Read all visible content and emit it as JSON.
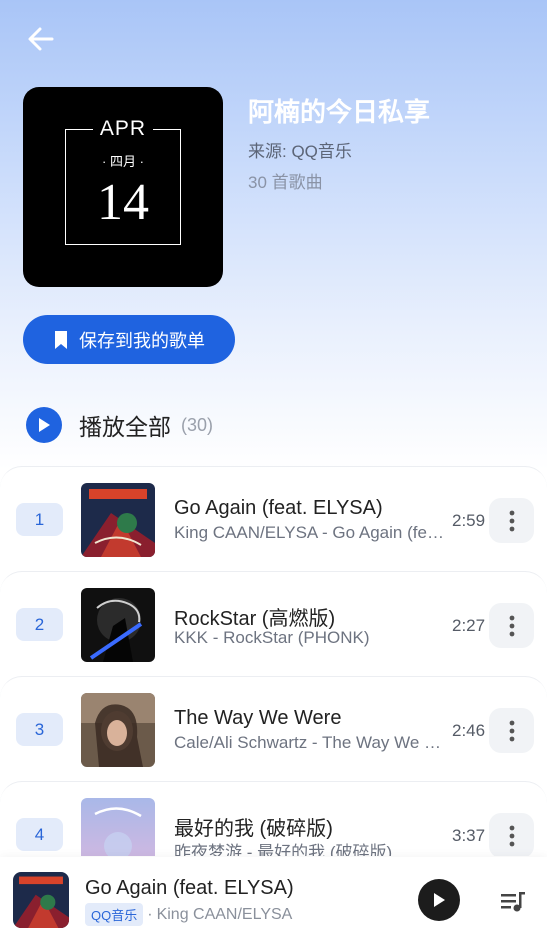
{
  "playlist": {
    "title": "阿楠的今日私享",
    "source": "来源: QQ音乐",
    "song_count": "30 首歌曲",
    "cover": {
      "month": "APR",
      "cn_month": "· 四月 ·",
      "day": "14"
    }
  },
  "save_button_label": "保存到我的歌单",
  "play_all": {
    "label": "播放全部",
    "count": "(30)"
  },
  "songs": [
    {
      "index": "1",
      "title": "Go Again (feat. ELYSA)",
      "subtitle": "King CAAN/ELYSA - Go Again (feat. ELYSA)",
      "duration": "2:59",
      "art": "go-again-cover"
    },
    {
      "index": "2",
      "title": "RockStar (高燃版)",
      "subtitle": "KKK - RockStar (PHONK)",
      "duration": "2:27",
      "art": "rockstar-cover"
    },
    {
      "index": "3",
      "title": "The Way We Were",
      "subtitle": "Cale/Ali Schwartz - The Way We Were",
      "duration": "2:46",
      "art": "the-way-we-were-cover"
    },
    {
      "index": "4",
      "title": "最好的我 (破碎版)",
      "subtitle": "昨夜梦游 - 最好的我 (破碎版)",
      "duration": "3:37",
      "art": "zuihao-de-wo-cover"
    }
  ],
  "now_playing": {
    "title": "Go Again (feat. ELYSA)",
    "source_tag": "QQ音乐",
    "separator": "·",
    "artist": "King CAAN/ELYSA"
  },
  "icons": {
    "back": "arrow-left-icon",
    "bookmark": "bookmark-icon",
    "play": "play-icon",
    "more": "more-vertical-icon",
    "queue": "playlist-queue-icon"
  },
  "colors": {
    "accent": "#1f63e0",
    "hero_top": "#a9c5f7",
    "index_bg": "#e3ebfa"
  }
}
